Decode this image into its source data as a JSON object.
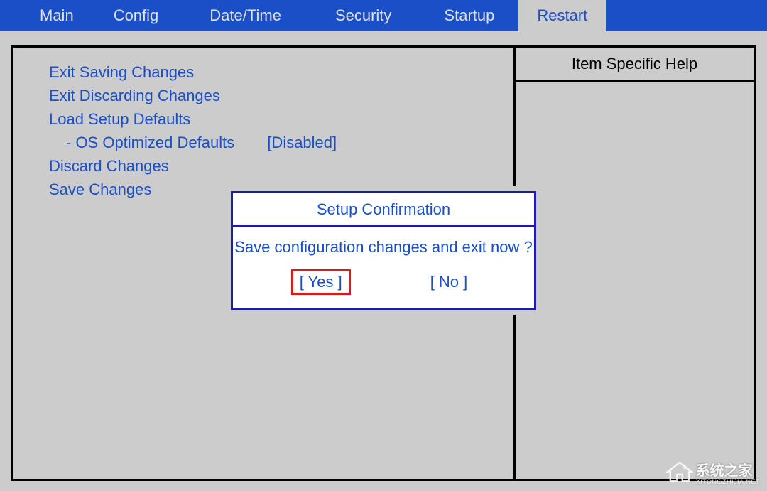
{
  "tabs": {
    "main": "Main",
    "config": "Config",
    "datetime": "Date/Time",
    "security": "Security",
    "startup": "Startup",
    "restart": "Restart"
  },
  "menu": {
    "exit_saving": "Exit Saving Changes",
    "exit_discarding": "Exit Discarding Changes",
    "load_defaults": "Load Setup Defaults",
    "os_optimized": "- OS Optimized Defaults",
    "os_optimized_value": "[Disabled]",
    "discard_changes": "Discard Changes",
    "save_changes": "Save Changes"
  },
  "help": {
    "header": "Item Specific Help"
  },
  "dialog": {
    "title": "Setup Confirmation",
    "message": "Save configuration changes and exit now ?",
    "yes": "[ Yes ]",
    "no": "[ No ]"
  },
  "watermark": {
    "text": "系统之家",
    "url": "XITONGZHIJIA.NET"
  }
}
